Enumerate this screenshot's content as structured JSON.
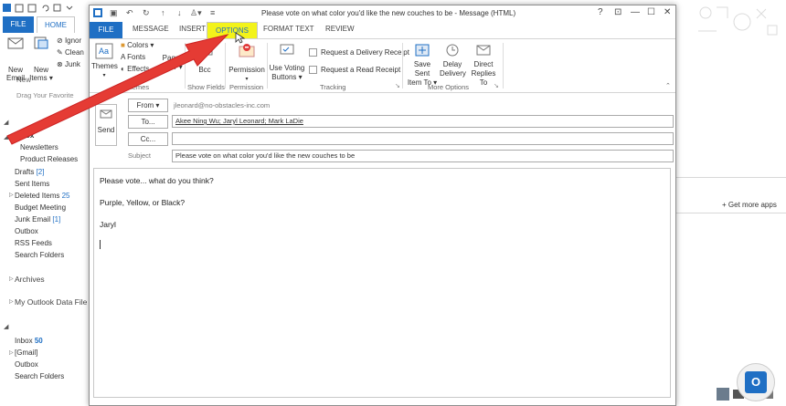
{
  "background_app": {
    "tabs": {
      "file": "FILE",
      "home": "HOME"
    },
    "ribbon": {
      "new_email": "New\nEmail",
      "new_items": "New\nItems",
      "ignore": "Ignor",
      "clean": "Clean",
      "junk": "Junk",
      "group_new": "New"
    },
    "drag_hint": "Drag Your Favorite",
    "folders": [
      {
        "label": "Inbox",
        "count": "",
        "bold": true
      },
      {
        "label": "Newsletters",
        "count": ""
      },
      {
        "label": "Product Releases",
        "count": ""
      },
      {
        "label": "Drafts",
        "count": "[2]"
      },
      {
        "label": "Sent Items",
        "count": ""
      },
      {
        "label": "Deleted Items",
        "count": "25"
      },
      {
        "label": "Budget Meeting",
        "count": ""
      },
      {
        "label": "Junk Email",
        "count": "[1]"
      },
      {
        "label": "Outbox",
        "count": ""
      },
      {
        "label": "RSS Feeds",
        "count": ""
      },
      {
        "label": "Search Folders",
        "count": ""
      }
    ],
    "archives": "Archives",
    "data_file": "My Outlook Data File",
    "gmail_folders": [
      {
        "label": "Inbox",
        "count": "50"
      },
      {
        "label": "[Gmail]",
        "count": ""
      },
      {
        "label": "Outbox",
        "count": ""
      },
      {
        "label": "Search Folders",
        "count": ""
      }
    ],
    "get_more_apps": "Get more apps"
  },
  "message_window": {
    "title": "Please vote on what color you'd like the new couches to be - Message (HTML)",
    "window_controls": {
      "help": "?",
      "restore_ribbon": "⊡",
      "minimize": "—",
      "maximize": "☐",
      "close": "✕"
    },
    "tabs": [
      "FILE",
      "MESSAGE",
      "INSERT",
      "OPTIONS",
      "FORMAT TEXT",
      "REVIEW"
    ],
    "ribbon": {
      "themes": "Themes",
      "colors": "Colors",
      "fonts": "Fonts",
      "effects": "Effects",
      "page_color": "Page\nColor",
      "bcc": "Bcc",
      "permission": "Permission",
      "use_voting_buttons": "Use Voting\nButtons",
      "request_delivery": "Request a Delivery Receipt",
      "request_read": "Request a Read Receipt",
      "save_sent_item_to": "Save Sent\nItem To",
      "delay_delivery": "Delay\nDelivery",
      "direct_replies_to": "Direct\nReplies To",
      "groups": {
        "themes": "Themes",
        "show_fields": "Show Fields",
        "permission": "Permission",
        "tracking": "Tracking",
        "more_options": "More Options"
      }
    },
    "fields": {
      "send": "Send",
      "from_label": "From",
      "from_value": "jleonard@no-obstacles-inc.com",
      "to_label": "To...",
      "to_value": "Akee Ning Wu; Jaryl Leonard; Mark LaDie",
      "cc_label": "Cc...",
      "cc_value": "",
      "subject_label": "Subject",
      "subject_value": "Please vote on what color you'd like the new couches to be"
    },
    "body": {
      "line1": "Please vote... what do you think?",
      "line2": "Purple, Yellow, or Black?",
      "line3": "Jaryl"
    }
  },
  "annotation": {
    "arrow_color": "#e53b34",
    "highlight_color": "#f3f31a"
  },
  "colors": {
    "accent": "#1f6fc4",
    "file_tab": "#1f6fc4"
  },
  "taskbar": {
    "outlook_letter": "O"
  }
}
